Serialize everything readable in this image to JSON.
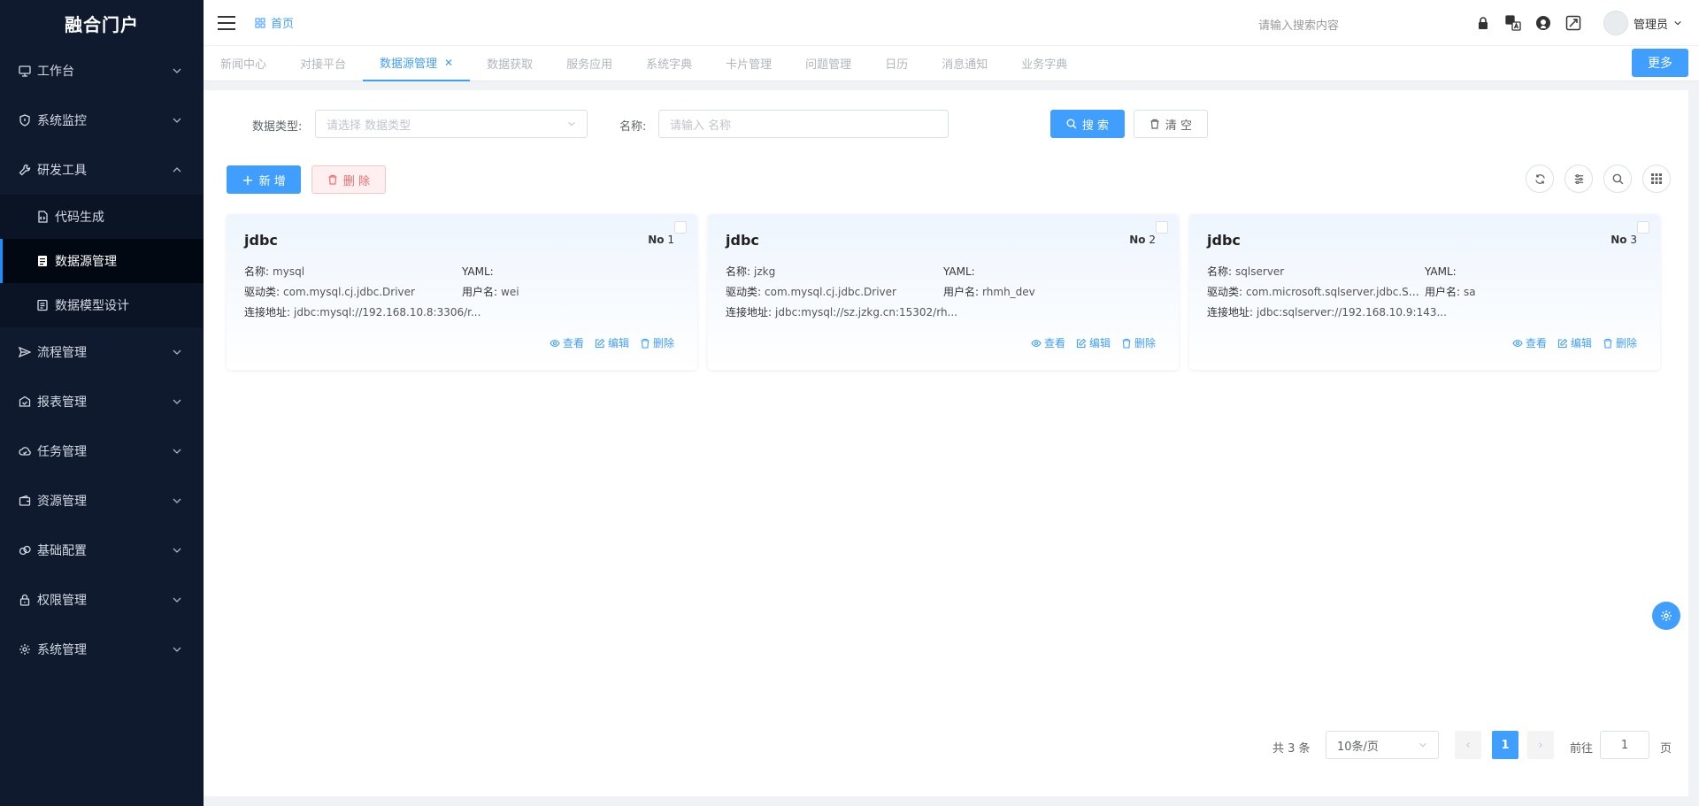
{
  "app": {
    "title": "融合门户"
  },
  "sidebar": {
    "items": [
      {
        "label": "工作台",
        "icon": "monitor-icon"
      },
      {
        "label": "系统监控",
        "icon": "shield-icon"
      },
      {
        "label": "研发工具",
        "icon": "wrench-icon",
        "expanded": true,
        "children": [
          {
            "label": "代码生成",
            "icon": "code-icon"
          },
          {
            "label": "数据源管理",
            "icon": "database-icon",
            "active": true
          },
          {
            "label": "数据模型设计",
            "icon": "model-icon"
          }
        ]
      },
      {
        "label": "流程管理",
        "icon": "send-icon"
      },
      {
        "label": "报表管理",
        "icon": "report-icon"
      },
      {
        "label": "任务管理",
        "icon": "cloud-icon"
      },
      {
        "label": "资源管理",
        "icon": "wallet-icon"
      },
      {
        "label": "基础配置",
        "icon": "link-icon"
      },
      {
        "label": "权限管理",
        "icon": "lock-icon"
      },
      {
        "label": "系统管理",
        "icon": "gear-icon"
      }
    ]
  },
  "header": {
    "breadcrumb": "首页",
    "search_placeholder": "请输入搜索内容",
    "user_name": "管理员"
  },
  "tabs": [
    {
      "label": "新闻中心"
    },
    {
      "label": "对接平台"
    },
    {
      "label": "数据源管理",
      "active": true,
      "closable": true
    },
    {
      "label": "数据获取"
    },
    {
      "label": "服务应用"
    },
    {
      "label": "系统字典"
    },
    {
      "label": "卡片管理"
    },
    {
      "label": "问题管理"
    },
    {
      "label": "日历"
    },
    {
      "label": "消息通知"
    },
    {
      "label": "业务字典"
    }
  ],
  "more_label": "更多",
  "filters": {
    "type_label": "数据类型:",
    "type_placeholder": "请选择 数据类型",
    "name_label": "名称:",
    "name_placeholder": "请输入 名称",
    "search_label": "搜 索",
    "clear_label": "清 空"
  },
  "actions": {
    "add_label": "新 增",
    "delete_label": "删 除"
  },
  "card_labels": {
    "name": "名称:",
    "yaml": "YAML:",
    "driver": "驱动类:",
    "username": "用户名:",
    "url": "连接地址:",
    "view": "查看",
    "edit": "编辑",
    "delete": "删除",
    "no": "No"
  },
  "cards": [
    {
      "title": "jdbc",
      "no": "1",
      "name": "mysql",
      "yaml": "",
      "driver": "com.mysql.cj.jdbc.Driver",
      "username": "wei",
      "url": "jdbc:mysql://192.168.10.8:3306/r..."
    },
    {
      "title": "jdbc",
      "no": "2",
      "name": "jzkg",
      "yaml": "",
      "driver": "com.mysql.cj.jdbc.Driver",
      "username": "rhmh_dev",
      "url": "jdbc:mysql://sz.jzkg.cn:15302/rh..."
    },
    {
      "title": "jdbc",
      "no": "3",
      "name": "sqlserver",
      "yaml": "",
      "driver": "com.microsoft.sqlserver.jdbc.SQLS...",
      "username": "sa",
      "url": "jdbc:sqlserver://192.168.10.9:143..."
    }
  ],
  "pagination": {
    "total": "共 3 条",
    "page_size": "10条/页",
    "current": "1",
    "goto_label": "前往",
    "goto_value": "1",
    "page_suffix": "页"
  },
  "colors": {
    "primary": "#409eff",
    "sidebar_bg": "#0f1a2e",
    "danger": "#f56c6c"
  }
}
